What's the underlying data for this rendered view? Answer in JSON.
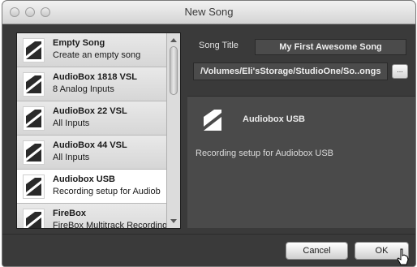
{
  "window": {
    "title": "New Song"
  },
  "song_list": {
    "items": [
      {
        "name": "Empty Song",
        "description": "Create an empty song",
        "icon": "song-template-icon",
        "selected": false
      },
      {
        "name": "AudioBox 1818 VSL",
        "description": "8 Analog Inputs",
        "icon": "song-template-icon",
        "selected": false
      },
      {
        "name": "AudioBox 22 VSL",
        "description": "All Inputs",
        "icon": "song-template-icon",
        "selected": false
      },
      {
        "name": "AudioBox 44 VSL",
        "description": "All Inputs",
        "icon": "song-template-icon",
        "selected": false
      },
      {
        "name": "Audiobox USB",
        "description": "Recording setup for Audiob",
        "icon": "song-template-icon",
        "selected": true
      },
      {
        "name": "FireBox",
        "description": "FireBox Multitrack Recording",
        "icon": "song-template-icon",
        "selected": false
      }
    ]
  },
  "song_title": {
    "label": "Song Title",
    "value": "My First Awesome Song"
  },
  "location": {
    "path": "/Volumes/Eli'sStorage/StudioOne/So..ongs",
    "browse_label": "..."
  },
  "detail": {
    "title": "Audiobox USB",
    "description": "Recording setup for Audiobox USB",
    "icon": "song-template-icon"
  },
  "buttons": {
    "cancel": "Cancel",
    "ok": "OK"
  },
  "colors": {
    "window_bg": "#3a3a3a",
    "list_bg": "#e5e5e5",
    "selected_item": "#ffffff",
    "panel_bg": "#4a4a4a"
  }
}
